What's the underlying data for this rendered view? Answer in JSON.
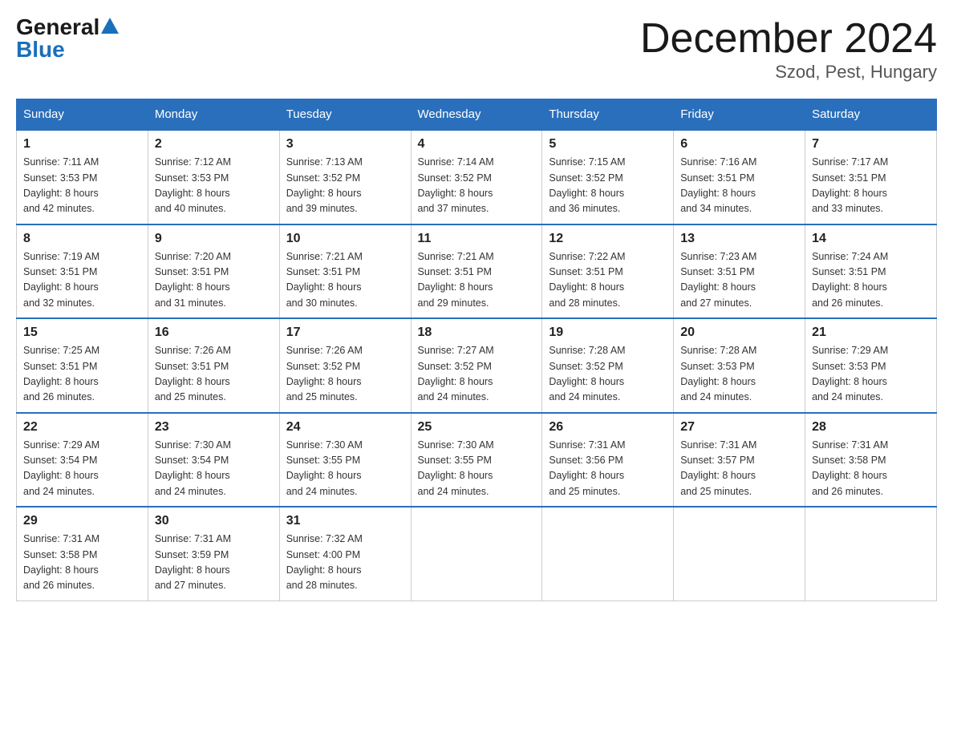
{
  "logo": {
    "general": "General",
    "blue": "Blue"
  },
  "title": "December 2024",
  "subtitle": "Szod, Pest, Hungary",
  "days_of_week": [
    "Sunday",
    "Monday",
    "Tuesday",
    "Wednesday",
    "Thursday",
    "Friday",
    "Saturday"
  ],
  "weeks": [
    [
      {
        "day": "1",
        "sunrise": "7:11 AM",
        "sunset": "3:53 PM",
        "daylight": "8 hours and 42 minutes."
      },
      {
        "day": "2",
        "sunrise": "7:12 AM",
        "sunset": "3:53 PM",
        "daylight": "8 hours and 40 minutes."
      },
      {
        "day": "3",
        "sunrise": "7:13 AM",
        "sunset": "3:52 PM",
        "daylight": "8 hours and 39 minutes."
      },
      {
        "day": "4",
        "sunrise": "7:14 AM",
        "sunset": "3:52 PM",
        "daylight": "8 hours and 37 minutes."
      },
      {
        "day": "5",
        "sunrise": "7:15 AM",
        "sunset": "3:52 PM",
        "daylight": "8 hours and 36 minutes."
      },
      {
        "day": "6",
        "sunrise": "7:16 AM",
        "sunset": "3:51 PM",
        "daylight": "8 hours and 34 minutes."
      },
      {
        "day": "7",
        "sunrise": "7:17 AM",
        "sunset": "3:51 PM",
        "daylight": "8 hours and 33 minutes."
      }
    ],
    [
      {
        "day": "8",
        "sunrise": "7:19 AM",
        "sunset": "3:51 PM",
        "daylight": "8 hours and 32 minutes."
      },
      {
        "day": "9",
        "sunrise": "7:20 AM",
        "sunset": "3:51 PM",
        "daylight": "8 hours and 31 minutes."
      },
      {
        "day": "10",
        "sunrise": "7:21 AM",
        "sunset": "3:51 PM",
        "daylight": "8 hours and 30 minutes."
      },
      {
        "day": "11",
        "sunrise": "7:21 AM",
        "sunset": "3:51 PM",
        "daylight": "8 hours and 29 minutes."
      },
      {
        "day": "12",
        "sunrise": "7:22 AM",
        "sunset": "3:51 PM",
        "daylight": "8 hours and 28 minutes."
      },
      {
        "day": "13",
        "sunrise": "7:23 AM",
        "sunset": "3:51 PM",
        "daylight": "8 hours and 27 minutes."
      },
      {
        "day": "14",
        "sunrise": "7:24 AM",
        "sunset": "3:51 PM",
        "daylight": "8 hours and 26 minutes."
      }
    ],
    [
      {
        "day": "15",
        "sunrise": "7:25 AM",
        "sunset": "3:51 PM",
        "daylight": "8 hours and 26 minutes."
      },
      {
        "day": "16",
        "sunrise": "7:26 AM",
        "sunset": "3:51 PM",
        "daylight": "8 hours and 25 minutes."
      },
      {
        "day": "17",
        "sunrise": "7:26 AM",
        "sunset": "3:52 PM",
        "daylight": "8 hours and 25 minutes."
      },
      {
        "day": "18",
        "sunrise": "7:27 AM",
        "sunset": "3:52 PM",
        "daylight": "8 hours and 24 minutes."
      },
      {
        "day": "19",
        "sunrise": "7:28 AM",
        "sunset": "3:52 PM",
        "daylight": "8 hours and 24 minutes."
      },
      {
        "day": "20",
        "sunrise": "7:28 AM",
        "sunset": "3:53 PM",
        "daylight": "8 hours and 24 minutes."
      },
      {
        "day": "21",
        "sunrise": "7:29 AM",
        "sunset": "3:53 PM",
        "daylight": "8 hours and 24 minutes."
      }
    ],
    [
      {
        "day": "22",
        "sunrise": "7:29 AM",
        "sunset": "3:54 PM",
        "daylight": "8 hours and 24 minutes."
      },
      {
        "day": "23",
        "sunrise": "7:30 AM",
        "sunset": "3:54 PM",
        "daylight": "8 hours and 24 minutes."
      },
      {
        "day": "24",
        "sunrise": "7:30 AM",
        "sunset": "3:55 PM",
        "daylight": "8 hours and 24 minutes."
      },
      {
        "day": "25",
        "sunrise": "7:30 AM",
        "sunset": "3:55 PM",
        "daylight": "8 hours and 24 minutes."
      },
      {
        "day": "26",
        "sunrise": "7:31 AM",
        "sunset": "3:56 PM",
        "daylight": "8 hours and 25 minutes."
      },
      {
        "day": "27",
        "sunrise": "7:31 AM",
        "sunset": "3:57 PM",
        "daylight": "8 hours and 25 minutes."
      },
      {
        "day": "28",
        "sunrise": "7:31 AM",
        "sunset": "3:58 PM",
        "daylight": "8 hours and 26 minutes."
      }
    ],
    [
      {
        "day": "29",
        "sunrise": "7:31 AM",
        "sunset": "3:58 PM",
        "daylight": "8 hours and 26 minutes."
      },
      {
        "day": "30",
        "sunrise": "7:31 AM",
        "sunset": "3:59 PM",
        "daylight": "8 hours and 27 minutes."
      },
      {
        "day": "31",
        "sunrise": "7:32 AM",
        "sunset": "4:00 PM",
        "daylight": "8 hours and 28 minutes."
      },
      null,
      null,
      null,
      null
    ]
  ],
  "labels": {
    "sunrise": "Sunrise:",
    "sunset": "Sunset:",
    "daylight": "Daylight:"
  }
}
